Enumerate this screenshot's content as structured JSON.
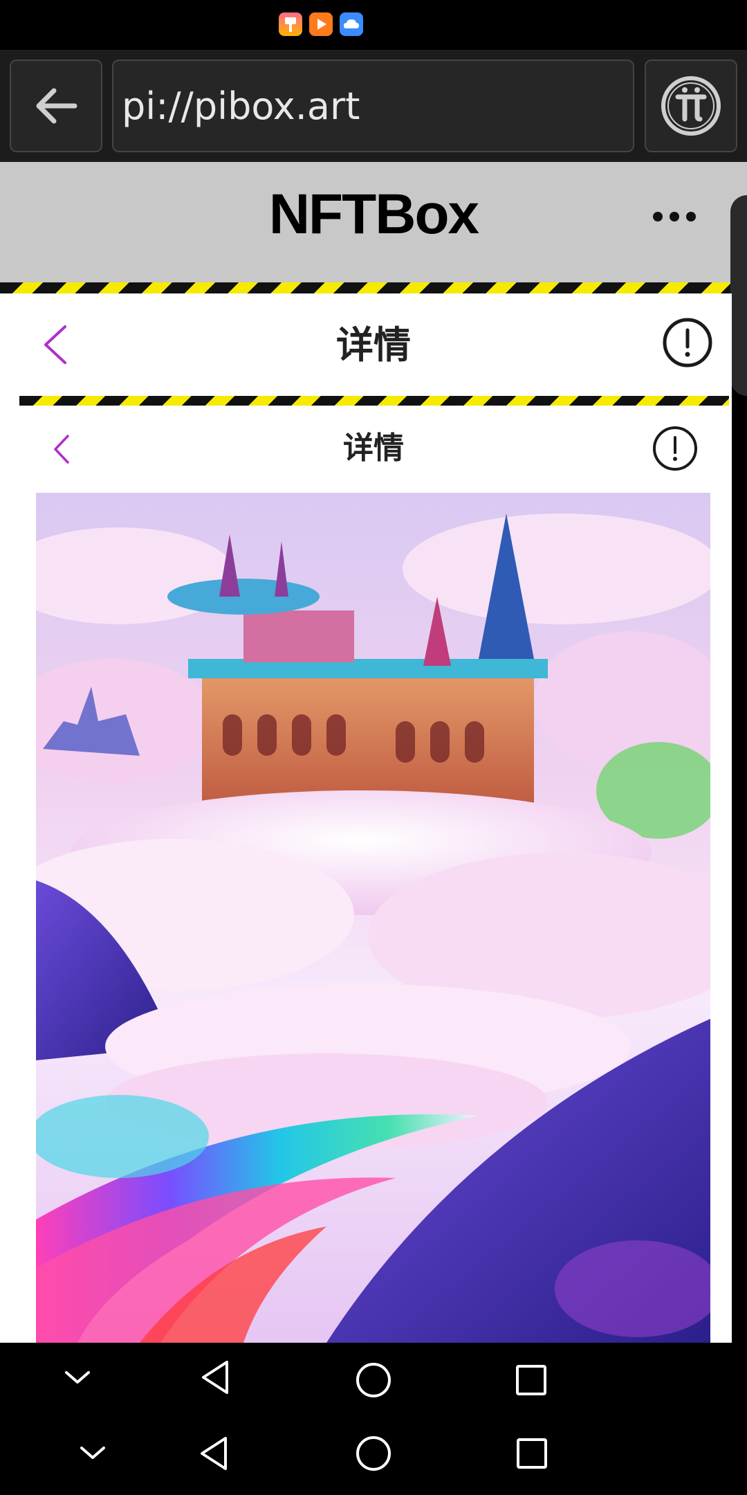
{
  "status_bar": {
    "icons": [
      "paint-app-icon",
      "play-app-icon",
      "cloud-app-icon"
    ],
    "icon_colors": [
      "#f0a030",
      "#ff7a1a",
      "#3b8cff"
    ]
  },
  "browser": {
    "url": "pi://pibox.art",
    "back_icon": "arrow-left-icon",
    "pi_icon": "pi-logo-icon"
  },
  "app": {
    "title": "NFTBox",
    "menu_icon": "more-dots-icon"
  },
  "detail": {
    "outer_title": "详情",
    "inner_title": "详情",
    "accent_color": "#b02ec9",
    "info_icon": "exclamation-circle-icon"
  },
  "artwork": {
    "subject": "castle-in-clouds-nft-image"
  },
  "nav": {
    "inner": [
      "chevron-down-icon",
      "back-triangle-icon",
      "home-circle-icon",
      "recent-square-icon"
    ],
    "outer": [
      "chevron-down-icon",
      "back-triangle-icon",
      "home-circle-icon",
      "recent-square-icon"
    ]
  }
}
